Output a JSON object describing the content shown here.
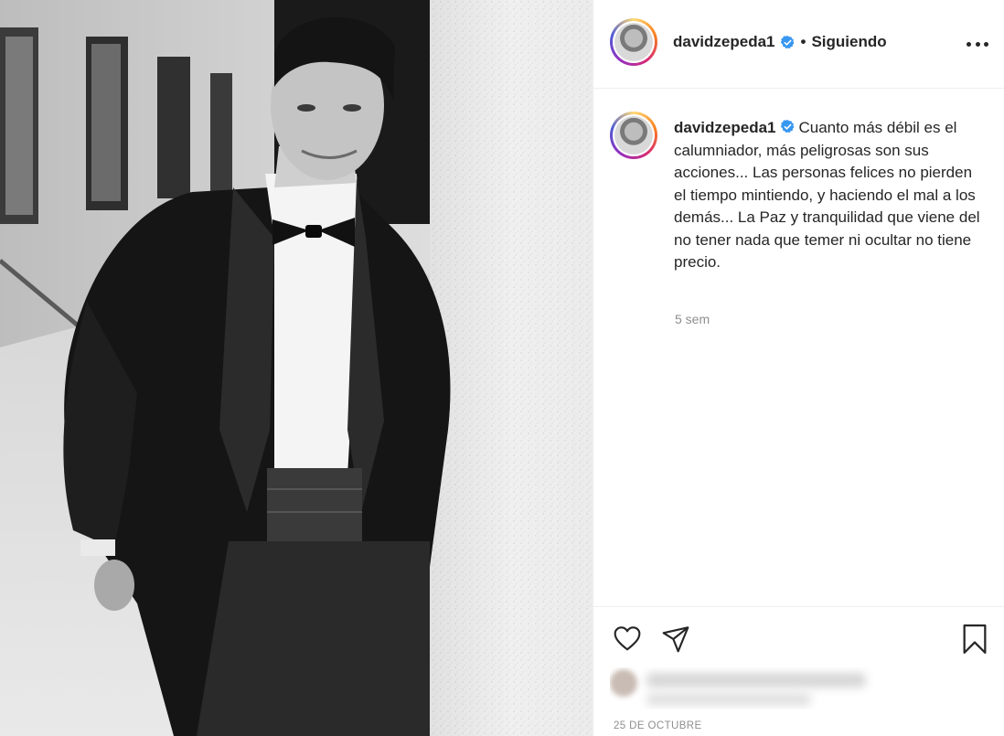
{
  "post": {
    "username": "davidzepeda1",
    "separator": "•",
    "follow_status": "Siguiendo",
    "caption": "Cuanto más débil es el calumniador, más peligrosas son sus acciones... Las personas felices no pierden el tiempo mintiendo, y haciendo el mal a los demás... La Paz y tranquilidad que viene del no tener nada que temer ni ocultar no tiene precio.",
    "time_ago": "5 sem",
    "date": "25 DE OCTUBRE"
  },
  "icons": {
    "more": "more-horizontal-icon",
    "verified": "verified-badge-icon",
    "like": "heart-icon",
    "share": "paper-plane-icon",
    "save": "bookmark-icon"
  },
  "colors": {
    "verified": "#3897f0",
    "text": "#262626",
    "muted": "#8e8e8e",
    "border": "#efefef"
  }
}
